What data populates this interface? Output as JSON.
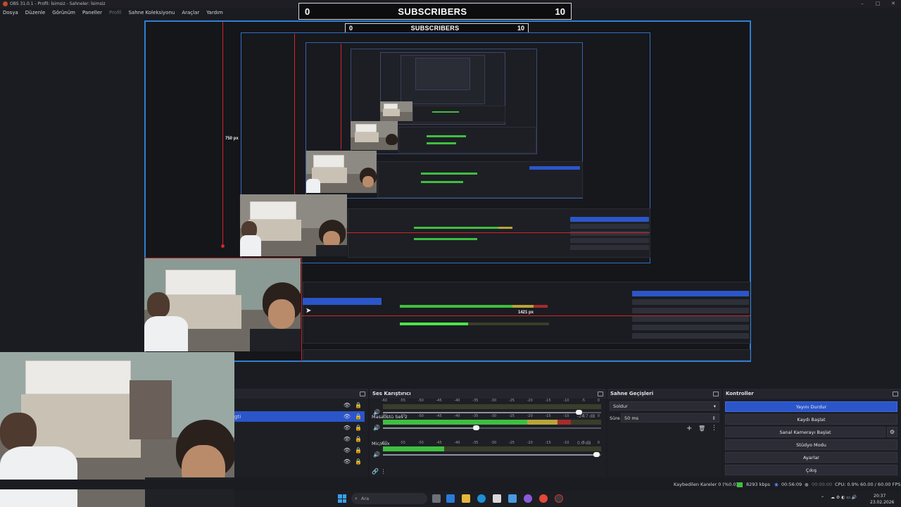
{
  "window": {
    "title": "OBS 31.0.1 - Profil: İsimsiz - Sahneler: İsimsiz"
  },
  "menu": [
    "Dosya",
    "Düzenle",
    "Görünüm",
    "Paneller",
    "Profil",
    "Sahne Koleksiyonu",
    "Araçlar",
    "Yardım"
  ],
  "subscribers": {
    "current": "0",
    "label": "SUBSCRIBERS",
    "goal": "10"
  },
  "preview": {
    "height_label": "750 px",
    "width_label": "1421 px"
  },
  "sources": {
    "selected_label": "gti"
  },
  "mixer": {
    "title": "Ses Karıştırıcı",
    "ticks": [
      "-60",
      "-55",
      "-50",
      "-45",
      "-40",
      "-35",
      "-30",
      "-25",
      "-20",
      "-15",
      "-10",
      "-5",
      "0"
    ],
    "channels": [
      {
        "name": "",
        "db": "",
        "level": 0,
        "volume": 0.9
      },
      {
        "name": "Masaüstü Ses 2",
        "db": "-24.7 dB",
        "level": 0.86,
        "volume": 0.43
      },
      {
        "name": "Mic/Aux",
        "db": "0.0 dB",
        "level": 0.28,
        "volume": 0.98
      }
    ]
  },
  "transitions": {
    "title": "Sahne Geçişleri",
    "type": "Soldur",
    "duration_label": "Süre",
    "duration": "50 ms"
  },
  "controls": {
    "title": "Kontroller",
    "stream": "Yayını Durdur",
    "record": "Kaydı Başlat",
    "vcam": "Sanal Kamerayı Başlat",
    "studio": "Stüdyo Modu",
    "settings": "Ayarlar",
    "exit": "Çıkış"
  },
  "status": {
    "dropped": "Kaybedilen Kareler 0 (%0.0)",
    "bitrate": "8293 kbps",
    "stream_time": "00:56:09",
    "rec_time": "00:00:00",
    "cpu": "CPU: 0.9%",
    "fps": "60.00 / 60.00 FPS"
  },
  "taskbar": {
    "search": "Ara",
    "time": "20:37",
    "date": "23.02.2026"
  },
  "colors": {
    "accent": "#2b56c9",
    "guide": "#d0262a",
    "meter_green": "#3fbf3f"
  }
}
